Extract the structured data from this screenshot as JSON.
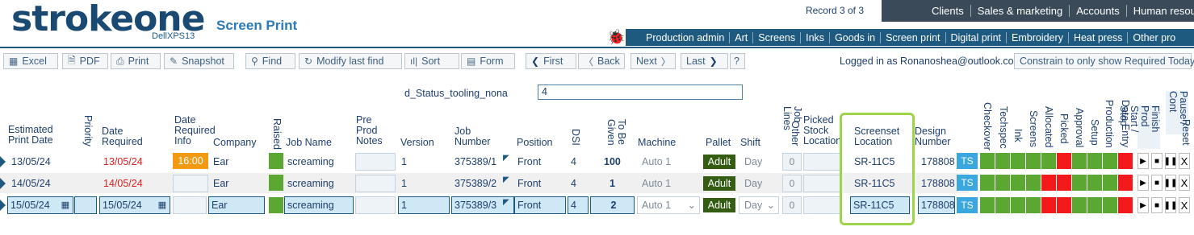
{
  "header": {
    "logo_text": "strokeone",
    "logo_sub": "DellXPS13",
    "page_title": "Screen Print",
    "record_text": "Record 3 of 3",
    "top_nav": [
      "Clients",
      "Sales & marketing",
      "Accounts",
      "Human resour"
    ],
    "sec_nav": [
      "Production admin",
      "Art",
      "Screens",
      "Inks",
      "Goods in",
      "Screen print",
      "Digital print",
      "Embroidery",
      "Heat press",
      "Other pro"
    ]
  },
  "toolbar": {
    "excel": "Excel",
    "pdf": "PDF",
    "print": "Print",
    "snapshot": "Snapshot",
    "find": "Find",
    "modify_last_find": "Modify last find",
    "sort": "Sort",
    "form": "Form",
    "first": "First",
    "back": "Back",
    "next": "Next",
    "last": "Last",
    "help": "?",
    "logged_in": "Logged in as Ronanoshea@outlook.com",
    "constrain": "Constrain to only show Required Today"
  },
  "filter": {
    "label": "d_Status_tooling_nona",
    "value": "4"
  },
  "columns": {
    "est_print_date": "Estimated Print Date",
    "priority": "Priority",
    "date_required": "Date Required",
    "date_required_info": "Date Required Info",
    "company": "Company",
    "raised": "Raised",
    "job_name": "Job Name",
    "pre_prod_notes": "Pre Prod Notes",
    "version": "Version",
    "job_number": "Job Number",
    "position": "Position",
    "dsi": "DSI",
    "to_be_given": "To Be Given",
    "machine": "Machine",
    "pallet": "Pallet",
    "shift": "Shift",
    "job_lines": "Job Lines",
    "other": "Other",
    "picked_stock_location": "Picked Stock Location",
    "screenset_location": "Screenset Location",
    "design_number": "Design Number",
    "checkover": "Checkover",
    "techspec": "Techspec",
    "ink": "Ink",
    "screens": "Screens",
    "allocated": "Allocated",
    "picked": "Picked",
    "approval": "Approval",
    "setup": "Setup",
    "production": "Production",
    "data_entry": "Data Entry",
    "finish_prod_start_stop": "Finish Prod Start / Stop",
    "pause_cont": "Pause / Cont",
    "reset": "Reset"
  },
  "rows": [
    {
      "est_date": "13/05/24",
      "date_required": "13/05/24",
      "info": "16:00",
      "company": "Ear",
      "job_name": "screaming",
      "version": "1",
      "job_number": "375389/1",
      "position": "Front",
      "dsi": "4",
      "to_be_given": "100",
      "machine": "Auto 1",
      "pallet": "Adult",
      "shift": "Day",
      "job_lines": "0",
      "screenset": "SR-11C5",
      "design": "178808",
      "ts": "TS"
    },
    {
      "est_date": "14/05/24",
      "date_required": "14/05/24",
      "info": "",
      "company": "Ear",
      "job_name": "screaming",
      "version": "1",
      "job_number": "375389/2",
      "position": "Front",
      "dsi": "4",
      "to_be_given": "1",
      "machine": "Auto 1",
      "pallet": "Adult",
      "shift": "Day",
      "job_lines": "0",
      "screenset": "SR-11C5",
      "design": "178808",
      "ts": "TS"
    },
    {
      "est_date": "15/05/24",
      "date_required": "15/05/24",
      "info": "",
      "company": "Ear",
      "job_name": "screaming",
      "version": "1",
      "job_number": "375389/3",
      "position": "Front",
      "dsi": "4",
      "to_be_given": "2",
      "machine": "Auto 1",
      "pallet": "Adult",
      "shift": "Day",
      "job_lines": "0",
      "screenset": "SR-11C5",
      "design": "178808",
      "ts": "TS"
    }
  ],
  "status_colors": {
    "green": "#5aa832",
    "red": "#f21a1a",
    "orange": "#f39a12",
    "dark_green": "#345c12",
    "ts_blue": "#3aa7df"
  },
  "status_grid": [
    [
      "green",
      "green",
      "green",
      "green",
      "green",
      "red",
      "green",
      "green",
      "green",
      "red"
    ],
    [
      "green",
      "green",
      "green",
      "green",
      "red",
      "red",
      "green",
      "green",
      "green",
      "red"
    ],
    [
      "green",
      "green",
      "green",
      "green",
      "red",
      "red",
      "green",
      "green",
      "green",
      "red"
    ]
  ],
  "controls": {
    "play": "▶",
    "stop": "■",
    "pause": "❚❚",
    "reset": "X"
  }
}
